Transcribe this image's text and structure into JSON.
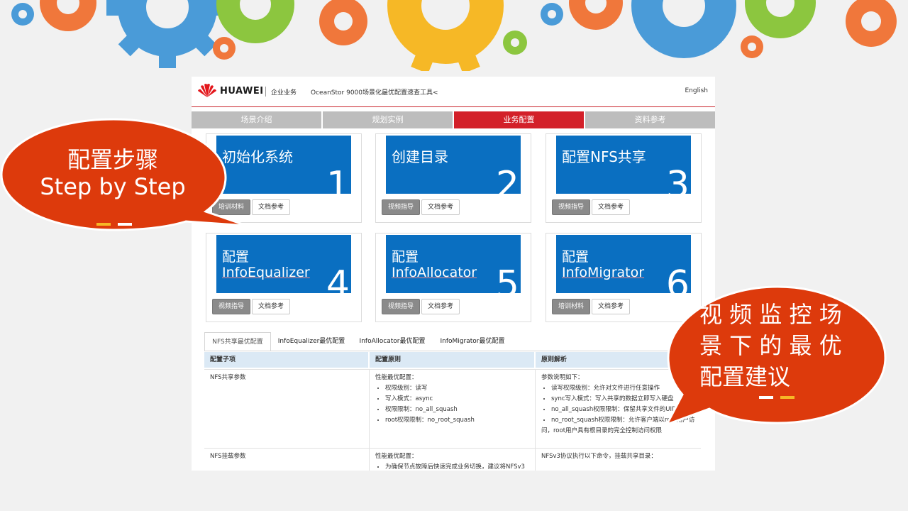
{
  "colors": {
    "accent_red": "#d32029",
    "tile_blue": "#0a6fc1",
    "callout_orange": "#dd3a0c",
    "nav_gray": "#bdbdbd"
  },
  "header": {
    "brand": "HUAWEI",
    "division": "企业业务",
    "tool_title": "OceanStor 9000场景化最优配置速查工具<",
    "lang_link": "English"
  },
  "nav": {
    "tabs": [
      {
        "label": "场景介绍",
        "active": false
      },
      {
        "label": "规划实例",
        "active": false
      },
      {
        "label": "业务配置",
        "active": true
      },
      {
        "label": "资料参考",
        "active": false
      }
    ]
  },
  "cards": [
    {
      "title": "初始化系统",
      "number": "1",
      "btn1": "培训材料",
      "btn2": "文档参考"
    },
    {
      "title": "创建目录",
      "number": "2",
      "btn1": "视频指导",
      "btn2": "文档参考"
    },
    {
      "title": "配置NFS共享",
      "number": "3",
      "btn1": "视频指导",
      "btn2": "文档参考"
    },
    {
      "title_l1": "配置",
      "title_l2": "InfoEqualizer",
      "number": "4",
      "btn1": "视频指导",
      "btn2": "文档参考"
    },
    {
      "title_l1": "配置",
      "title_l2": "InfoAllocator",
      "number": "5",
      "btn1": "视频指导",
      "btn2": "文档参考"
    },
    {
      "title_l1": "配置",
      "title_l2": "InfoMigrator",
      "number": "6",
      "btn1": "培训材料",
      "btn2": "文档参考"
    }
  ],
  "sub_tabs": [
    "NFS共享最优配置",
    "InfoEqualizer最优配置",
    "InfoAllocator最优配置",
    "InfoMigrator最优配置"
  ],
  "table": {
    "headers": [
      "配置子项",
      "配置原则",
      "原则解析"
    ],
    "rows": [
      {
        "item": "NFS共享参数",
        "principle_intro": "性能最优配置：",
        "principles": [
          "权限级别：读写",
          "写入模式：async",
          "权限限制：no_all_squash",
          "root权限限制：no_root_squash"
        ],
        "analysis_intro": "参数说明如下：",
        "analysis": [
          "读写权限级别：允许对文件进行任意操作",
          "sync写入模式：写入共享的数据立即写入硬盘",
          "no_all_squash权限限制：保留共享文件的UID和",
          "no_root_squash权限限制：允许客户端以root用户访",
          "问，root用户具有根目录的完全控制访问权限"
        ]
      },
      {
        "item": "NFS挂载参数",
        "principle_intro": "性能最优配置：",
        "principles": [
          "为确保节点故障后快速完成业务切换，建议将NFSv3"
        ],
        "analysis_intro": "NFSv3协议执行以下命令，挂载共享目录："
      }
    ]
  },
  "callouts": {
    "left_line1": "配置步骤",
    "left_line2": "Step by Step",
    "right_line1": "视 频 监 控 场",
    "right_line2": "景 下 的 最 优",
    "right_line3": "配置建议"
  }
}
